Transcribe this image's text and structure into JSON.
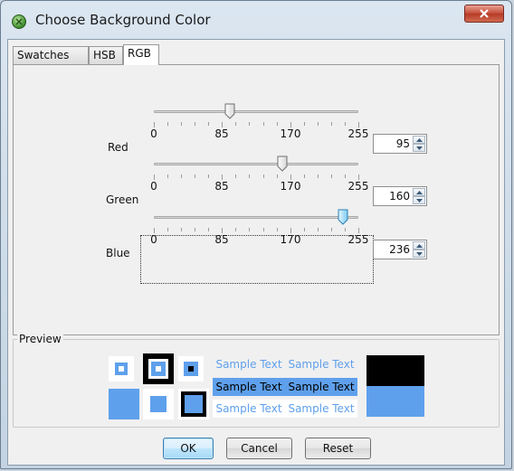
{
  "window": {
    "title": "Choose Background Color",
    "close_label": "X"
  },
  "tabs": [
    {
      "label": "Swatches",
      "mnemonic": "S"
    },
    {
      "label": "HSB",
      "mnemonic": "H"
    },
    {
      "label": "RGB",
      "mnemonic": "G",
      "active": true
    }
  ],
  "rgb": {
    "ticks": [
      "0",
      "85",
      "170",
      "255"
    ],
    "channels": [
      {
        "name": "Red",
        "value": 95
      },
      {
        "name": "Green",
        "value": 160
      },
      {
        "name": "Blue",
        "value": 236
      }
    ]
  },
  "preview": {
    "title": "Preview",
    "color": "#5fa0ec",
    "sample_text": "Sample Text"
  },
  "buttons": {
    "ok": "OK",
    "cancel": "Cancel",
    "reset": "Reset"
  }
}
